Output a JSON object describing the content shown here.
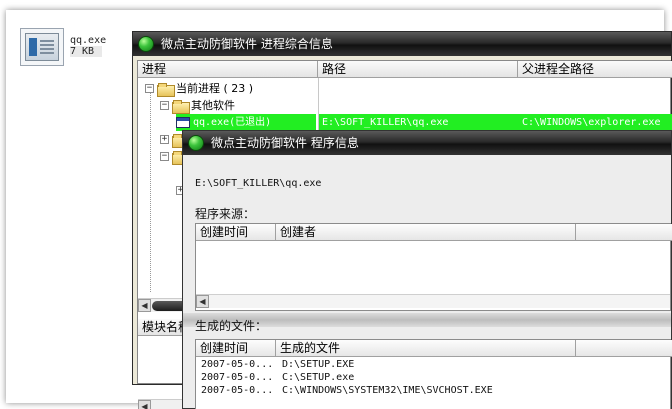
{
  "desktop_file": {
    "name": "qq.exe",
    "size": "7 KB"
  },
  "main_window": {
    "title": "微点主动防御软件  进程综合信息",
    "columns": [
      "进程",
      "路径",
      "父进程全路径"
    ],
    "tree": {
      "root": "当前进程 ( 23 )",
      "group": "其他软件",
      "selected_item": "qq.exe(已退出)"
    },
    "selected_path": "E:\\SOFT_KILLER\\qq.exe",
    "selected_parent_path": "C:\\WINDOWS\\explorer.exe",
    "module_header": "模块名称"
  },
  "program_window": {
    "title": "微点主动防御软件  程序信息",
    "exe_path": "E:\\SOFT_KILLER\\qq.exe",
    "source_label": "程序来源：",
    "source_columns": [
      "创建时间",
      "创建者"
    ],
    "generated_label": "生成的文件：",
    "generated_columns": [
      "创建时间",
      "生成的文件"
    ],
    "generated_rows": [
      {
        "time": "2007-05-0...",
        "file": "D:\\SETUP.EXE"
      },
      {
        "time": "2007-05-0...",
        "file": "C:\\SETUP.exe"
      },
      {
        "time": "2007-05-0...",
        "file": "C:\\WINDOWS\\SYSTEM32\\IME\\SVCHOST.EXE"
      }
    ]
  }
}
